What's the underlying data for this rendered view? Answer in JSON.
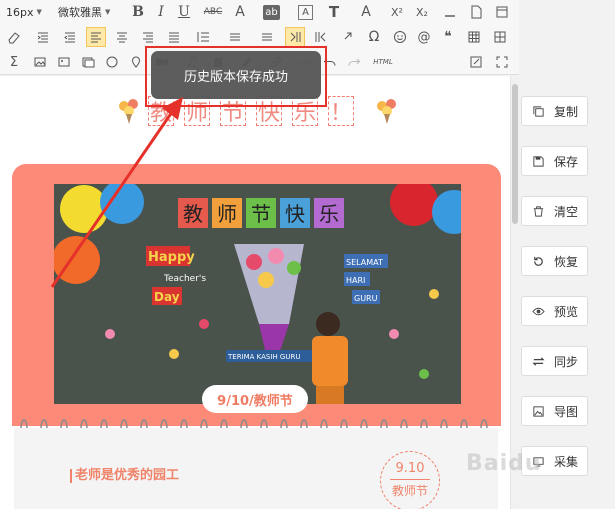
{
  "toolbar": {
    "font_size": "16px",
    "font_family": "微软雅黑",
    "bold": "B",
    "italic": "I",
    "underline": "U",
    "strikethrough": "ABC",
    "font_color": "A",
    "highlight": "ab",
    "border_text": "A",
    "text_style": "T",
    "text_effect": "A",
    "superscript": "X²",
    "subscript": "X₂",
    "html_label": "HTML",
    "quote_mark": "❝"
  },
  "toast": {
    "message": "历史版本保存成功"
  },
  "editor": {
    "title_chars": [
      "教",
      "师",
      "节",
      "快",
      "乐",
      "！"
    ],
    "photo_banner": [
      "教",
      "师",
      "节",
      "快",
      "乐"
    ],
    "photo_text_happy": "Happy",
    "photo_text_teachers": "Teacher's",
    "photo_text_day": "Day",
    "photo_text_selamat": "SELAMAT",
    "photo_text_hari": "HARI",
    "photo_text_guru": "GURU",
    "photo_text_terima": "TERIMA KASIH GURU",
    "date_tag": "9/10/教师节",
    "subtitle": "老师是优秀的园工",
    "stamp_date": "9.10",
    "stamp_name": "教师节"
  },
  "side_buttons": [
    {
      "label": "复制",
      "icon": "copy-icon"
    },
    {
      "label": "保存",
      "icon": "save-icon"
    },
    {
      "label": "清空",
      "icon": "trash-icon"
    },
    {
      "label": "恢复",
      "icon": "restore-icon"
    },
    {
      "label": "预览",
      "icon": "eye-icon"
    },
    {
      "label": "同步",
      "icon": "sync-icon"
    },
    {
      "label": "导图",
      "icon": "image-export-icon"
    },
    {
      "label": "采集",
      "icon": "collect-icon"
    }
  ],
  "watermark": "Baidu",
  "colors": {
    "accent": "#fc8a78",
    "highlight_red": "#e5312a",
    "toast_bg": "#575757",
    "active_tool": "#ffe9a8"
  }
}
